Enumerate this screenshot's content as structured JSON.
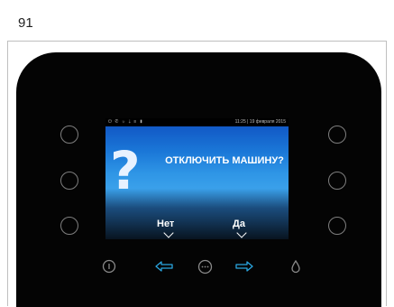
{
  "page": {
    "number": "91"
  },
  "screen": {
    "status_icons": "⏻ ✆ ☼ ⇣ ≡ ▮",
    "datetime": "11:25 | 19 февраля 2015",
    "question_icon": "?",
    "message": "ОТКЛЮЧИТЬ МАШИНУ?",
    "option_no": "Нет",
    "option_yes": "Да"
  },
  "controls": {
    "icons": [
      "info-icon",
      "arrow-left-icon",
      "menu-dots-icon",
      "arrow-right-icon",
      "water-drop-icon"
    ],
    "accent_color": "#2aa6e0",
    "icon_color": "#8a8a8a"
  },
  "device": {
    "side_buttons": 6,
    "body_color": "#040404"
  }
}
